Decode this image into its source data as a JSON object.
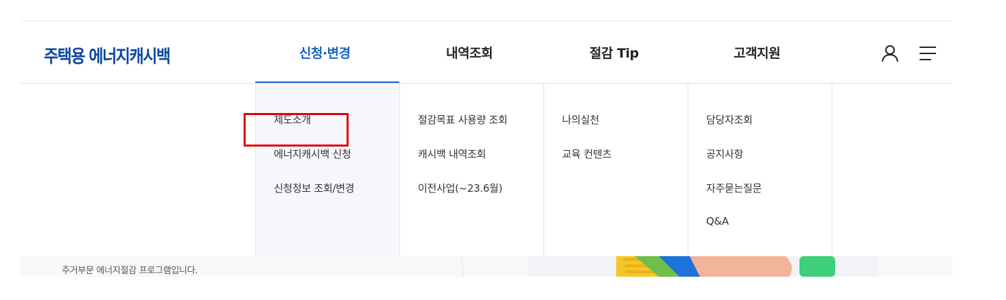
{
  "header": {
    "logo": "주택용 에너지캐시백",
    "nav": [
      {
        "label": "신청·변경",
        "active": true
      },
      {
        "label": "내역조회",
        "active": false
      },
      {
        "label": "절감 Tip",
        "active": false
      },
      {
        "label": "고객지원",
        "active": false
      }
    ],
    "icons": [
      "user-icon",
      "hamburger-menu-icon"
    ]
  },
  "dropdown": {
    "col1": [
      "제도소개",
      "에너지캐시백 신청",
      "신청정보 조회/변경"
    ],
    "col2": [
      "절감목표 사용량 조회",
      "캐시백 내역조회",
      "이전사업(~23.6월)"
    ],
    "col3": [
      "나의실천",
      "교육 컨텐츠"
    ],
    "col4": [
      "담당자조회",
      "공지사항",
      "자주묻는질문",
      "Q&A"
    ]
  },
  "background_page": {
    "description_line": "주거부문 에너지절감 프로그램입니다."
  },
  "colors": {
    "accent": "#1565c0",
    "logo": "#0d47a1",
    "highlight_box": "#e00000"
  }
}
